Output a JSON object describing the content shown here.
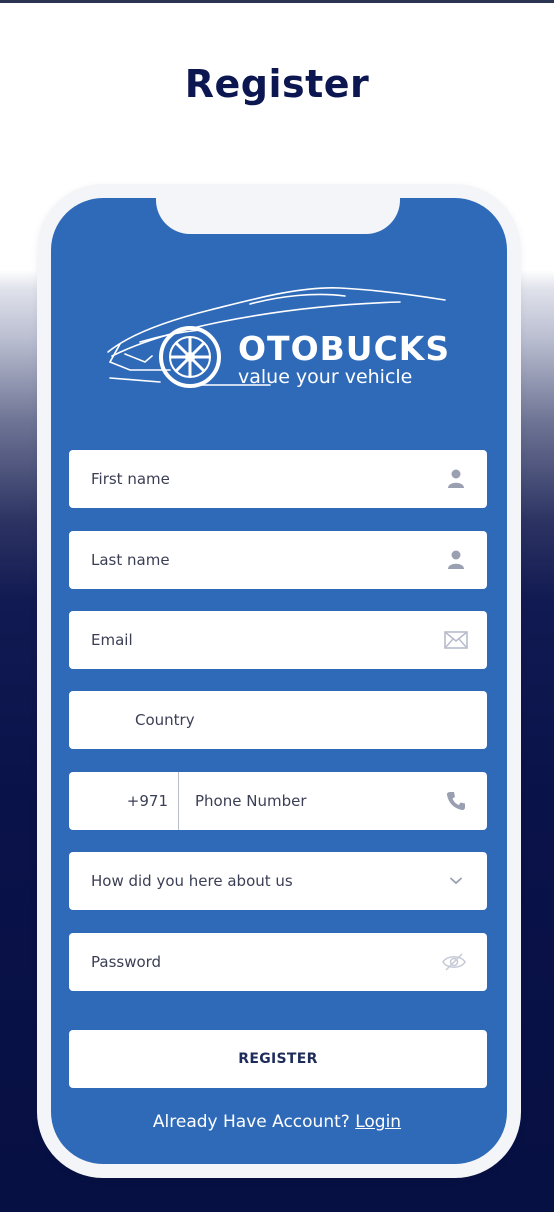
{
  "page": {
    "title": "Register"
  },
  "brand": {
    "name": "OTOBUCKS",
    "tagline": "value your vehicle"
  },
  "form": {
    "first_name": {
      "placeholder": "First name",
      "icon": "user-icon"
    },
    "last_name": {
      "placeholder": "Last name",
      "icon": "user-icon"
    },
    "email": {
      "placeholder": "Email",
      "icon": "envelope-icon"
    },
    "country": {
      "placeholder": "Country"
    },
    "phone": {
      "code": "+971",
      "placeholder": "Phone Number",
      "icon": "phone-icon"
    },
    "referral": {
      "placeholder": "How did you here about us",
      "icon": "chevron-down-icon"
    },
    "password": {
      "placeholder": "Password",
      "icon": "eye-slash-icon"
    }
  },
  "actions": {
    "register_label": "REGISTER"
  },
  "footer": {
    "prompt": "Already Have Account?",
    "login_label": "Login"
  },
  "colors": {
    "screen": "#2f6ab9",
    "title": "#0c1650",
    "frame": "#f4f5f8"
  }
}
